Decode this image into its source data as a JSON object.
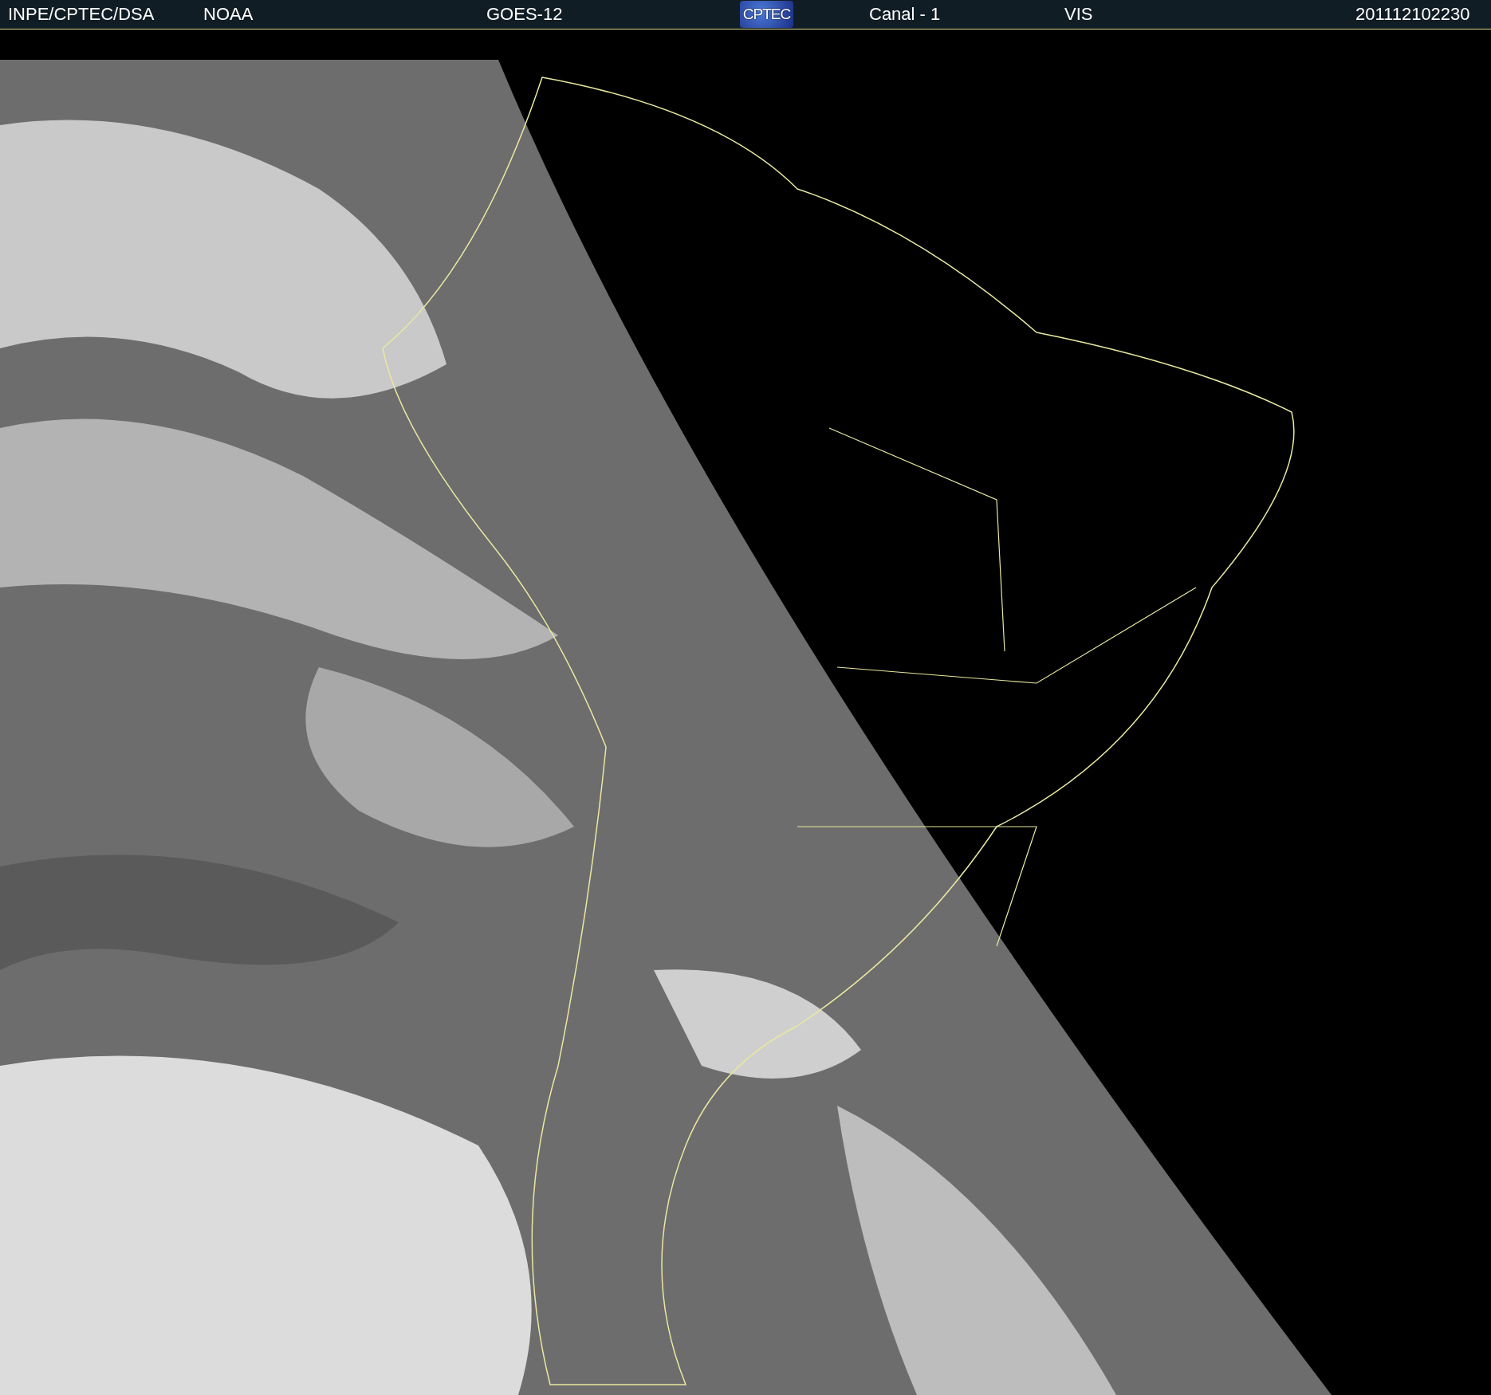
{
  "header": {
    "source": "INPE/CPTEC/DSA",
    "agency": "NOAA",
    "satellite": "GOES-12",
    "logo": "CPTEC",
    "channel": "Canal - 1",
    "band": "VIS",
    "timestamp": "201112102230"
  }
}
